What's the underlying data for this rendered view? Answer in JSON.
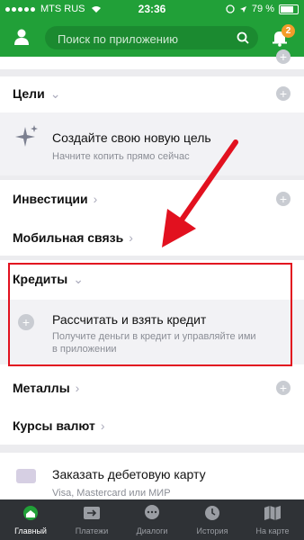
{
  "status_bar": {
    "carrier": "MTS RUS",
    "time": "23:36",
    "battery": "79 %"
  },
  "header": {
    "search_placeholder": "Поиск по приложению",
    "notification_count": "2"
  },
  "sections": {
    "goals": {
      "title": "Цели",
      "create_title": "Создайте свою новую цель",
      "create_desc": "Начните копить прямо сейчас"
    },
    "investments": {
      "title": "Инвестиции"
    },
    "mobile": {
      "title": "Мобильная связь"
    },
    "credits": {
      "title": "Кредиты",
      "calc_title": "Рассчитать и взять кредит",
      "calc_desc_1": "Получите деньги в кредит и управляйте ими",
      "calc_desc_2": "в приложении"
    },
    "metals": {
      "title": "Металлы"
    },
    "currency": {
      "title": "Курсы валют"
    },
    "debit": {
      "title": "Заказать дебетовую карту",
      "desc": "Visa, Mastercard или МИР"
    }
  },
  "tabbar": {
    "items": [
      {
        "label": "Главный",
        "icon": "home-icon"
      },
      {
        "label": "Платежи",
        "icon": "transfer-icon"
      },
      {
        "label": "Диалоги",
        "icon": "chat-icon"
      },
      {
        "label": "История",
        "icon": "clock-icon"
      },
      {
        "label": "На карте",
        "icon": "map-icon"
      }
    ]
  },
  "colors": {
    "brand": "#21a038",
    "accent_badge": "#f39c2a",
    "annotation": "#e2111f",
    "tabbar": "#2f3236"
  }
}
